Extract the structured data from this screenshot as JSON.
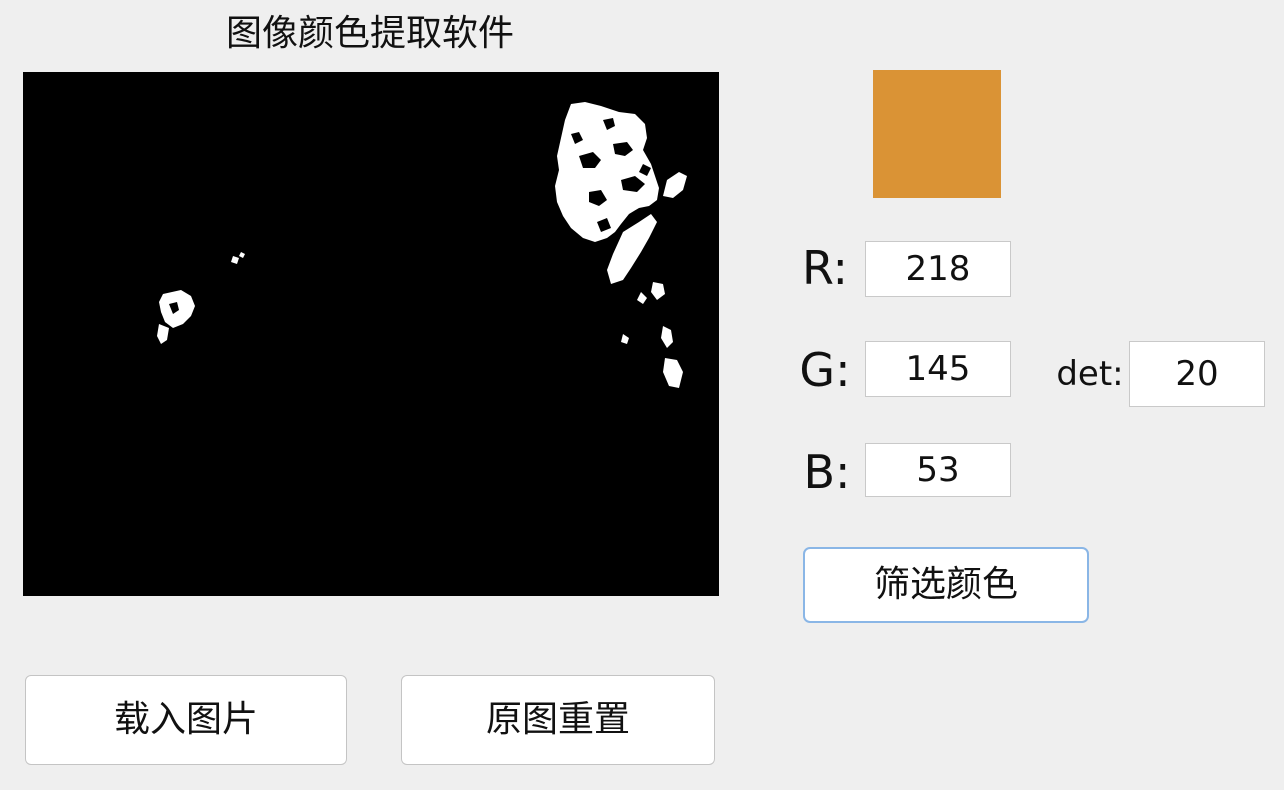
{
  "window": {
    "title": "图像颜色提取软件"
  },
  "swatch": {
    "color": "#da9335"
  },
  "channels": {
    "r_label": "R:",
    "r_value": "218",
    "g_label": "G:",
    "g_value": "145",
    "b_label": "B:",
    "b_value": "53"
  },
  "threshold": {
    "label": "det:",
    "value": "20"
  },
  "buttons": {
    "filter_label": "筛选颜色",
    "load_label": "载入图片",
    "reset_label": "原图重置"
  },
  "preview": {
    "background_color": "#000000",
    "mask_color": "#ffffff"
  }
}
